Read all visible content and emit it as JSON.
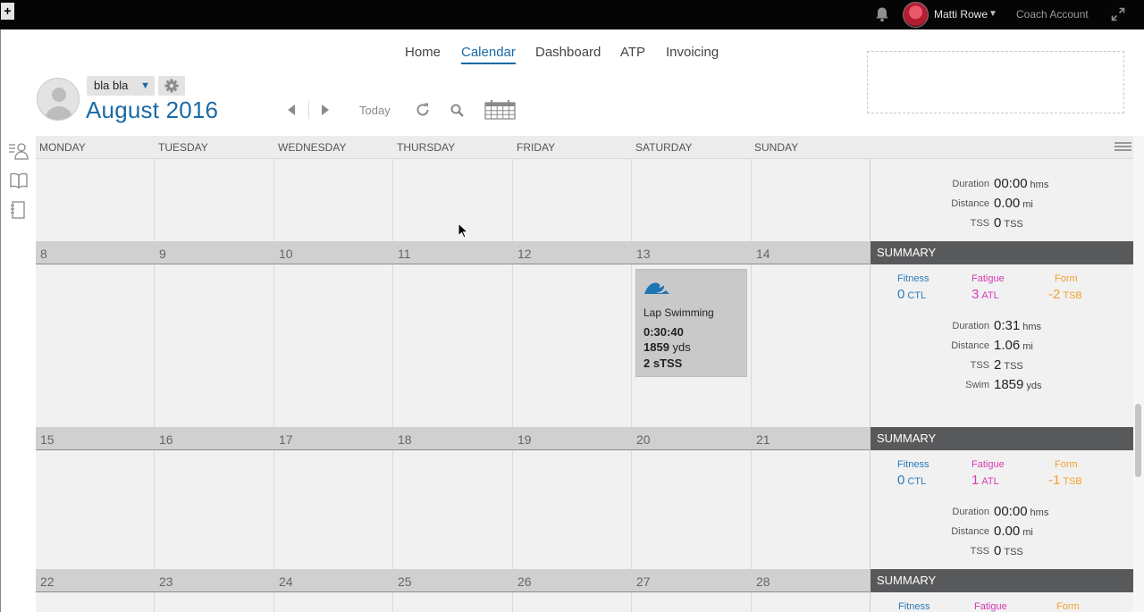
{
  "topbar": {
    "plus_label": "+",
    "user_name": "Matti Rowe",
    "coach_account": "Coach Account",
    "icons": [
      "bell-icon",
      "user-avatar",
      "caret-down-icon",
      "expand-icon"
    ]
  },
  "nav": {
    "items": [
      {
        "label": "Home"
      },
      {
        "label": "Calendar"
      },
      {
        "label": "Dashboard"
      },
      {
        "label": "ATP"
      },
      {
        "label": "Invoicing"
      }
    ],
    "active": "Calendar"
  },
  "athlete": {
    "name": "bla bla"
  },
  "calendar": {
    "month_title": "August 2016",
    "today_label": "Today",
    "day_names": [
      "MONDAY",
      "TUESDAY",
      "WEDNESDAY",
      "THURSDAY",
      "FRIDAY",
      "SATURDAY",
      "SUNDAY"
    ],
    "weeks": [
      {
        "dates": [
          "8",
          "9",
          "10",
          "11",
          "12",
          "13",
          "14"
        ]
      },
      {
        "dates": [
          "15",
          "16",
          "17",
          "18",
          "19",
          "20",
          "21"
        ]
      },
      {
        "dates": [
          "22",
          "23",
          "24",
          "25",
          "26",
          "27",
          "28"
        ]
      }
    ]
  },
  "workout": {
    "title": "Lap Swimming",
    "duration": "0:30:40",
    "distance_value": "1859",
    "distance_unit": "yds",
    "stss": "2 sTSS"
  },
  "summary": {
    "header_label": "SUMMARY",
    "labels": {
      "fitness": "Fitness",
      "fatigue": "Fatigue",
      "form": "Form",
      "duration": "Duration",
      "distance": "Distance",
      "tss": "TSS",
      "swim": "Swim"
    },
    "units": {
      "ctl": "CTL",
      "atl": "ATL",
      "tsb": "TSB",
      "hms": "hms",
      "mi": "mi",
      "tss": "TSS",
      "yds": "yds"
    },
    "prev_week": {
      "duration": "00:00",
      "distance": "0.00",
      "tss": "0"
    },
    "week1": {
      "fitness": "0",
      "fatigue": "3",
      "form": "-2",
      "duration": "0:31",
      "distance": "1.06",
      "tss": "2",
      "swim": "1859"
    },
    "week2": {
      "fitness": "0",
      "fatigue": "1",
      "form": "-1",
      "duration": "00:00",
      "distance": "0.00",
      "tss": "0"
    }
  },
  "colors": {
    "accent": "#1b6aa6",
    "fitness": "#2b7bb9",
    "fatigue": "#d63ab5",
    "form": "#f2a030",
    "summary_header": "#58595b",
    "topbar": "#050505"
  }
}
